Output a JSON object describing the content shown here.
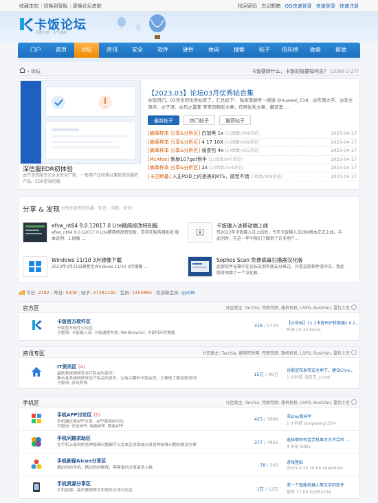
{
  "topbar": {
    "left": [
      "收藏本站",
      "切换到宽版",
      "更换论坛皮肤"
    ],
    "right": [
      "找回密码",
      "忘记邮箱",
      "QQ快速登录",
      "快速登录",
      "快速注册"
    ]
  },
  "logo": {
    "title": "卡饭论坛",
    "slogan": "互助分享　大气谦和"
  },
  "nav": [
    "门户",
    "首页",
    "论坛",
    "资讯",
    "安全",
    "软件",
    "硬件",
    "休闲",
    "搜索",
    "帖子",
    "伯乐榜",
    "勋章",
    "帮助"
  ],
  "nav_active": 2,
  "breadcrumb": {
    "path": "论坛",
    "notice": "卡饭要转什么，卡饭的隐要知何去？",
    "notice_date": "(2008-2-27)"
  },
  "feature": {
    "slide_caption": "深信服EDR初体验",
    "slide_desc": "由于深信服专注企业安全厂家，一般用户比较难以兼到深信服的产品。EDR是深信服",
    "title": "【2023.03】论坛03月优秀帖合集",
    "desc": "@饭团们，03月份的优秀帖来了，汇总如下：  贴家率颖考～感谢 @huawei_518、@东南大学、@安全测评、@子语、@风之翼苍 等来的精彩文章；任用优秀文章、翻这里 ...",
    "tabs": [
      "最新帖子",
      "热门帖子",
      "推荐帖子"
    ],
    "rows": [
      {
        "tag": "[病毒样本 分享&分析区]",
        "title": "白加黑 1x",
        "count": "[15回复/364浏览]",
        "date": "2023-04-17"
      },
      {
        "tag": "[病毒样本 分享&分析区]",
        "title": "4 17 10X",
        "count": "[10回复/469浏览]",
        "date": "2023-04-17"
      },
      {
        "tag": "[病毒样本 分享&分析区]",
        "title": "误查包 4x",
        "count": "[14回复/415浏览]",
        "date": "2023-04-17"
      },
      {
        "tag": "[McAfee]",
        "title": "新版107get到手",
        "count": "[11回复/247浏览]",
        "date": "2023-04-17"
      },
      {
        "tag": "[病毒样本 分享&分析区]",
        "title": "2x",
        "count": "[10回复/344浏览]",
        "date": "2023-04-17"
      },
      {
        "tag": "[卡巴斯基]",
        "title": "入正PDD上的查表的KTS，感觉不错",
        "count": "[7回复/309浏览]",
        "date": "2023-04-17"
      }
    ]
  },
  "share": {
    "title": "分享 & 发现",
    "subtitle": "分享你发现的乐趣、知识、问题、佳作!",
    "items": [
      {
        "title": "efsw_nt64 9.0.12017.0 Lite精简修改特别版",
        "desc": "efsw_nt64 9.0.12017.0 Lite精简修改特别版，支持在服务器系统 板本说明：1.屏蔽 ..."
      },
      {
        "title": "卡饭输入法移动端上线",
        "desc": "形2022年卡饭输入法上线后，今天卡饭输入法289根本正式上线。与此同时，在这一年中我们了解到了许多用户..."
      },
      {
        "title": "Windows 11/10 3月镜像下载",
        "desc": "2023年3月21日更新至Windows 11/10 3月镜像 ..."
      },
      {
        "title": "Sophos Scan 免费病毒扫描器汉化版",
        "desc": "此款软件无需中在论坛见到有朋友分享过，只是这款软件没中文，我此版时间增了一个汉化板 ..."
      }
    ]
  },
  "stats": {
    "today_label": "今日:",
    "today": "2192",
    "yesterday_label": "昨日:",
    "yesterday": "5208",
    "posts_label": "帖子:",
    "posts": "47281192",
    "members_label": "会员:",
    "members": "1455885",
    "newest_label": "欢迎新会员:",
    "newest": "gyz08"
  },
  "sections": [
    {
      "title": "官方区",
      "mods": "分区版主: Tarchia, 荒颜荒颜, 翅机机机, LSPD, BushYan, 雷包土豆",
      "forums": [
        {
          "name": "卡饭官方软件区",
          "today": "",
          "desc": "卡饭官方软件讨论区",
          "desc2": "子版块: 卡饭输入法, 卡饭通理大师, MiniBrowser, 卡饭PDF转换器",
          "threads": "316",
          "posts": "5719",
          "last": "【公告贴】11.1卡饭PDF转换器2.0.2...",
          "last_time": "昨天 20:30 twtxk"
        }
      ]
    },
    {
      "title": "资讯专区",
      "mods": "分区版主: Tarchia, 留得阵税明, 荒颜荒颜, 翅机机机, LSPD, BushYan, 雷包土豆",
      "forums": [
        {
          "name": "IT资讯区",
          "today": "(4)",
          "desc": "最新系统网络安全IT有关的资讯!",
          "desc2": "聚合各系统网络安全IT有关的资讯，让有兴趣的卡饭会员、方便他了解这些资讯!",
          "desc3": "子版块: 资讯荐饰",
          "threads": "15万",
          "posts": "99万",
          "last": "谷歌宣布发布安全地下。建议Chro...",
          "last_time": "1 小时前 海克王_ccmd"
        }
      ]
    },
    {
      "title": "手机区",
      "mods": "分区版主: Tarchia, 荒颜荒颜, 翅机机机, LSPD, BushYan, 雷包土豆",
      "forums": [
        {
          "name": "手机APP讨论区",
          "today": "(5)",
          "desc": "手机端优秀APP分享，APP使用的讨论",
          "desc2": "子版块: 安全APP, 电脑APP, 费用APP",
          "threads": "425",
          "posts": "7699",
          "last": "求play版APP",
          "last_time": "1 小时前 songwang1314"
        },
        {
          "name": "手机问题求助区",
          "today": "",
          "desc": "在手机上碰到的各种疑难问题都可以在本区求助或分享各种疑难问题的解决方案",
          "desc2": "",
          "threads": "377",
          "posts": "4921",
          "last": "选择哪种有连手机果对方不会听 ...",
          "last_time": "4 天前 lklklx"
        },
        {
          "name": "手机刷保&icon分享区",
          "today": "",
          "desc": "精出你的手机、精出你的屏保、客套谁的分享最多人数",
          "desc2": "",
          "threads": "78",
          "posts": "561",
          "last": "游戏壁纸",
          "last_time": "2023-3-15 10:06 ximenhao"
        },
        {
          "name": "手机资源分享区",
          "today": "",
          "desc": "手机资源、高机教程等手机软件交流讨论区",
          "desc2": "",
          "threads": "1万",
          "posts": "12万",
          "last": "求一个智能机器人等文字的软件",
          "last_time": "前天 17:06 fzc852258"
        }
      ]
    }
  ]
}
